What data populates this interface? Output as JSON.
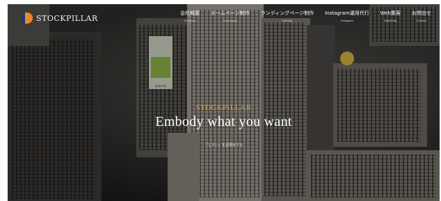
{
  "header": {
    "brand_name": "STOCKPILLAR",
    "logo_colors": {
      "orange": "#e8892b",
      "navy": "#1f3a6b"
    }
  },
  "nav": [
    {
      "label": "会社概要",
      "sub": "Company"
    },
    {
      "label": "ホームページ制作",
      "sub": "Homepage"
    },
    {
      "label": "ランディングページ制作",
      "sub": "Landing"
    },
    {
      "label": "Instagram運用代行",
      "sub": "Instagram"
    },
    {
      "label": "Web集客",
      "sub": "Marketing"
    },
    {
      "label": "お問合せ",
      "sub": "Contact"
    }
  ],
  "hero": {
    "brand": "STOCKPILLAR",
    "headline": "Embody what you want",
    "tagline": "「したい」を具現化する",
    "billboard_text": "eperney"
  }
}
